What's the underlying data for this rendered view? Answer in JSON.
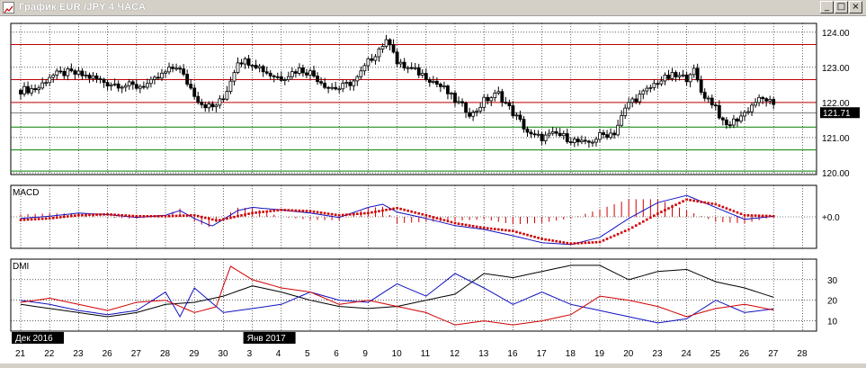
{
  "window": {
    "title": "График EUR /JPY  4 ЧАСА",
    "minimize_glyph": "_",
    "maximize_glyph": "□",
    "close_glyph": "×"
  },
  "colors": {
    "background": "#ffffff",
    "grid": "#000000",
    "red_level": "#c00000",
    "green_level": "#008000",
    "macd_line": "#1010c0",
    "signal_dots": "#d00000",
    "histogram": "#d00000",
    "dmi_adx": "#000000",
    "dmi_plus": "#1010c0",
    "dmi_minus": "#d00000",
    "price_label_bg": "#000000"
  },
  "chart_data": [
    {
      "type": "candlestick",
      "title": "",
      "ylim": [
        119.95,
        124.25
      ],
      "yticks": [
        120,
        121,
        122,
        123,
        124
      ],
      "ytick_labels": [
        "120.00",
        "121.00",
        "122.00",
        "123.00",
        "124.00"
      ],
      "last_price_label": "121.71",
      "last_price": 121.71,
      "red_levels": [
        123.65,
        122.65,
        122.0
      ],
      "green_levels": [
        121.3,
        120.65,
        120.05
      ],
      "price_path": [
        {
          "x": 0,
          "y": 122.35
        },
        {
          "x": 0.6,
          "y": 122.4
        },
        {
          "x": 1.0,
          "y": 122.75
        },
        {
          "x": 1.6,
          "y": 122.85
        },
        {
          "x": 2.0,
          "y": 122.8
        },
        {
          "x": 2.5,
          "y": 122.7
        },
        {
          "x": 3.0,
          "y": 122.55
        },
        {
          "x": 3.6,
          "y": 122.5
        },
        {
          "x": 4.0,
          "y": 122.45
        },
        {
          "x": 4.5,
          "y": 122.55
        },
        {
          "x": 5.0,
          "y": 122.85
        },
        {
          "x": 5.4,
          "y": 123.05
        },
        {
          "x": 5.8,
          "y": 122.5
        },
        {
          "x": 6.2,
          "y": 122.0
        },
        {
          "x": 6.6,
          "y": 121.85
        },
        {
          "x": 7.0,
          "y": 122.1
        },
        {
          "x": 7.5,
          "y": 123.2
        },
        {
          "x": 8.0,
          "y": 123.15
        },
        {
          "x": 8.6,
          "y": 122.8
        },
        {
          "x": 9.0,
          "y": 122.7
        },
        {
          "x": 9.6,
          "y": 122.95
        },
        {
          "x": 10.0,
          "y": 122.85
        },
        {
          "x": 10.6,
          "y": 122.45
        },
        {
          "x": 11.0,
          "y": 122.4
        },
        {
          "x": 11.6,
          "y": 122.65
        },
        {
          "x": 12.0,
          "y": 123.15
        },
        {
          "x": 12.5,
          "y": 123.65
        },
        {
          "x": 12.8,
          "y": 123.75
        },
        {
          "x": 13.0,
          "y": 123.1
        },
        {
          "x": 13.6,
          "y": 122.9
        },
        {
          "x": 14.0,
          "y": 122.75
        },
        {
          "x": 14.6,
          "y": 122.4
        },
        {
          "x": 15.0,
          "y": 122.05
        },
        {
          "x": 15.6,
          "y": 121.65
        },
        {
          "x": 16.0,
          "y": 122.05
        },
        {
          "x": 16.5,
          "y": 122.25
        },
        {
          "x": 17.0,
          "y": 121.7
        },
        {
          "x": 17.3,
          "y": 121.4
        },
        {
          "x": 17.6,
          "y": 121.05
        },
        {
          "x": 18.0,
          "y": 121.0
        },
        {
          "x": 18.5,
          "y": 121.1
        },
        {
          "x": 19.0,
          "y": 120.95
        },
        {
          "x": 19.5,
          "y": 120.8
        },
        {
          "x": 20.0,
          "y": 121.05
        },
        {
          "x": 20.5,
          "y": 121.15
        },
        {
          "x": 21.0,
          "y": 122.0
        },
        {
          "x": 21.5,
          "y": 122.25
        },
        {
          "x": 22.0,
          "y": 122.6
        },
        {
          "x": 22.5,
          "y": 122.75
        },
        {
          "x": 23.0,
          "y": 122.7
        },
        {
          "x": 23.2,
          "y": 123.0
        },
        {
          "x": 23.5,
          "y": 122.3
        },
        {
          "x": 24.0,
          "y": 121.9
        },
        {
          "x": 24.3,
          "y": 121.3
        },
        {
          "x": 24.6,
          "y": 121.45
        },
        {
          "x": 25.0,
          "y": 121.7
        },
        {
          "x": 25.4,
          "y": 122.05
        },
        {
          "x": 25.8,
          "y": 122.1
        },
        {
          "x": 26.1,
          "y": 121.71
        }
      ]
    },
    {
      "type": "macd",
      "title": "MACD",
      "ylim": [
        -1.0,
        1.0
      ],
      "zero_label": "+0.0",
      "macd_line": [
        {
          "x": 0,
          "y": -0.05
        },
        {
          "x": 1,
          "y": 0.02
        },
        {
          "x": 2,
          "y": 0.12
        },
        {
          "x": 3,
          "y": 0.07
        },
        {
          "x": 4,
          "y": -0.02
        },
        {
          "x": 5,
          "y": 0.05
        },
        {
          "x": 5.5,
          "y": 0.2
        },
        {
          "x": 6,
          "y": -0.05
        },
        {
          "x": 6.6,
          "y": -0.3
        },
        {
          "x": 7.5,
          "y": 0.2
        },
        {
          "x": 8,
          "y": 0.3
        },
        {
          "x": 9,
          "y": 0.22
        },
        {
          "x": 10,
          "y": 0.12
        },
        {
          "x": 11,
          "y": -0.02
        },
        {
          "x": 12,
          "y": 0.3
        },
        {
          "x": 12.5,
          "y": 0.4
        },
        {
          "x": 13,
          "y": 0.15
        },
        {
          "x": 14,
          "y": -0.05
        },
        {
          "x": 15,
          "y": -0.28
        },
        {
          "x": 16,
          "y": -0.4
        },
        {
          "x": 17,
          "y": -0.6
        },
        {
          "x": 18,
          "y": -0.82
        },
        {
          "x": 19,
          "y": -0.88
        },
        {
          "x": 20,
          "y": -0.65
        },
        {
          "x": 21,
          "y": -0.05
        },
        {
          "x": 22,
          "y": 0.45
        },
        {
          "x": 23,
          "y": 0.68
        },
        {
          "x": 24,
          "y": 0.3
        },
        {
          "x": 25,
          "y": -0.08
        },
        {
          "x": 26.1,
          "y": 0.03
        }
      ],
      "signal_line": [
        {
          "x": 0,
          "y": -0.1
        },
        {
          "x": 1,
          "y": -0.05
        },
        {
          "x": 2,
          "y": 0.05
        },
        {
          "x": 3,
          "y": 0.08
        },
        {
          "x": 4,
          "y": 0.02
        },
        {
          "x": 5,
          "y": 0.02
        },
        {
          "x": 6,
          "y": 0.05
        },
        {
          "x": 6.8,
          "y": -0.12
        },
        {
          "x": 8,
          "y": 0.12
        },
        {
          "x": 9,
          "y": 0.22
        },
        {
          "x": 10,
          "y": 0.18
        },
        {
          "x": 11,
          "y": 0.05
        },
        {
          "x": 12,
          "y": 0.12
        },
        {
          "x": 13,
          "y": 0.28
        },
        {
          "x": 14,
          "y": 0.05
        },
        {
          "x": 15,
          "y": -0.2
        },
        {
          "x": 16,
          "y": -0.35
        },
        {
          "x": 17,
          "y": -0.45
        },
        {
          "x": 18,
          "y": -0.7
        },
        {
          "x": 19,
          "y": -0.85
        },
        {
          "x": 20,
          "y": -0.8
        },
        {
          "x": 21,
          "y": -0.4
        },
        {
          "x": 22,
          "y": 0.1
        },
        {
          "x": 23,
          "y": 0.55
        },
        {
          "x": 24,
          "y": 0.4
        },
        {
          "x": 25,
          "y": 0.05
        },
        {
          "x": 26.1,
          "y": 0.02
        }
      ]
    },
    {
      "type": "dmi",
      "title": "DMI",
      "ylim": [
        5,
        40
      ],
      "yticks": [
        10,
        20,
        30
      ],
      "ytick_labels": [
        "10",
        "20",
        "30"
      ],
      "adx": [
        {
          "x": 0,
          "y": 18
        },
        {
          "x": 1,
          "y": 16
        },
        {
          "x": 2,
          "y": 14
        },
        {
          "x": 3,
          "y": 12
        },
        {
          "x": 4,
          "y": 14
        },
        {
          "x": 5,
          "y": 18
        },
        {
          "x": 6,
          "y": 19
        },
        {
          "x": 7,
          "y": 22
        },
        {
          "x": 8,
          "y": 27
        },
        {
          "x": 9,
          "y": 24
        },
        {
          "x": 10,
          "y": 20
        },
        {
          "x": 11,
          "y": 17
        },
        {
          "x": 12,
          "y": 16
        },
        {
          "x": 13,
          "y": 17
        },
        {
          "x": 14,
          "y": 20
        },
        {
          "x": 15,
          "y": 23
        },
        {
          "x": 16,
          "y": 33
        },
        {
          "x": 17,
          "y": 31
        },
        {
          "x": 18,
          "y": 34
        },
        {
          "x": 19,
          "y": 37
        },
        {
          "x": 20,
          "y": 37
        },
        {
          "x": 21,
          "y": 30
        },
        {
          "x": 22,
          "y": 34
        },
        {
          "x": 23,
          "y": 35
        },
        {
          "x": 24,
          "y": 29
        },
        {
          "x": 25,
          "y": 26
        },
        {
          "x": 26.1,
          "y": 21
        }
      ],
      "di_plus": [
        {
          "x": 0,
          "y": 20
        },
        {
          "x": 1,
          "y": 18
        },
        {
          "x": 2,
          "y": 15
        },
        {
          "x": 3,
          "y": 13
        },
        {
          "x": 4,
          "y": 15
        },
        {
          "x": 5,
          "y": 24
        },
        {
          "x": 5.5,
          "y": 12
        },
        {
          "x": 6,
          "y": 26
        },
        {
          "x": 7,
          "y": 14
        },
        {
          "x": 8,
          "y": 16
        },
        {
          "x": 9,
          "y": 18
        },
        {
          "x": 10,
          "y": 24
        },
        {
          "x": 11,
          "y": 20
        },
        {
          "x": 12,
          "y": 19
        },
        {
          "x": 13,
          "y": 28
        },
        {
          "x": 14,
          "y": 22
        },
        {
          "x": 15,
          "y": 33
        },
        {
          "x": 16,
          "y": 26
        },
        {
          "x": 17,
          "y": 18
        },
        {
          "x": 18,
          "y": 24
        },
        {
          "x": 19,
          "y": 18
        },
        {
          "x": 20,
          "y": 15
        },
        {
          "x": 21,
          "y": 12
        },
        {
          "x": 22,
          "y": 9
        },
        {
          "x": 23,
          "y": 11
        },
        {
          "x": 24,
          "y": 20
        },
        {
          "x": 25,
          "y": 14
        },
        {
          "x": 26.1,
          "y": 16
        }
      ],
      "di_minus": [
        {
          "x": 0,
          "y": 19
        },
        {
          "x": 1,
          "y": 21
        },
        {
          "x": 2,
          "y": 18
        },
        {
          "x": 3,
          "y": 15
        },
        {
          "x": 4,
          "y": 19
        },
        {
          "x": 5,
          "y": 20
        },
        {
          "x": 6,
          "y": 14
        },
        {
          "x": 6.8,
          "y": 17
        },
        {
          "x": 7.2,
          "y": 37
        },
        {
          "x": 8,
          "y": 30
        },
        {
          "x": 9,
          "y": 26
        },
        {
          "x": 10,
          "y": 24
        },
        {
          "x": 11,
          "y": 18
        },
        {
          "x": 12,
          "y": 20
        },
        {
          "x": 13,
          "y": 17
        },
        {
          "x": 14,
          "y": 14
        },
        {
          "x": 15,
          "y": 8
        },
        {
          "x": 16,
          "y": 10
        },
        {
          "x": 17,
          "y": 8
        },
        {
          "x": 18,
          "y": 10
        },
        {
          "x": 19,
          "y": 13
        },
        {
          "x": 20,
          "y": 22
        },
        {
          "x": 21,
          "y": 20
        },
        {
          "x": 22,
          "y": 17
        },
        {
          "x": 23,
          "y": 12
        },
        {
          "x": 24,
          "y": 16
        },
        {
          "x": 25,
          "y": 18
        },
        {
          "x": 26.1,
          "y": 15
        }
      ]
    }
  ],
  "x_axis": {
    "labels": [
      "21",
      "22",
      "23",
      "26",
      "27",
      "28",
      "29",
      "30",
      "3",
      "4",
      "5",
      "6",
      "9",
      "10",
      "11",
      "12",
      "13",
      "16",
      "17",
      "18",
      "19",
      "20",
      "23",
      "24",
      "25",
      "26",
      "27",
      "28"
    ],
    "month_labels": [
      {
        "text": "Дек 2016",
        "x": 0
      },
      {
        "text": "Янв 2017",
        "x": 8
      }
    ]
  }
}
